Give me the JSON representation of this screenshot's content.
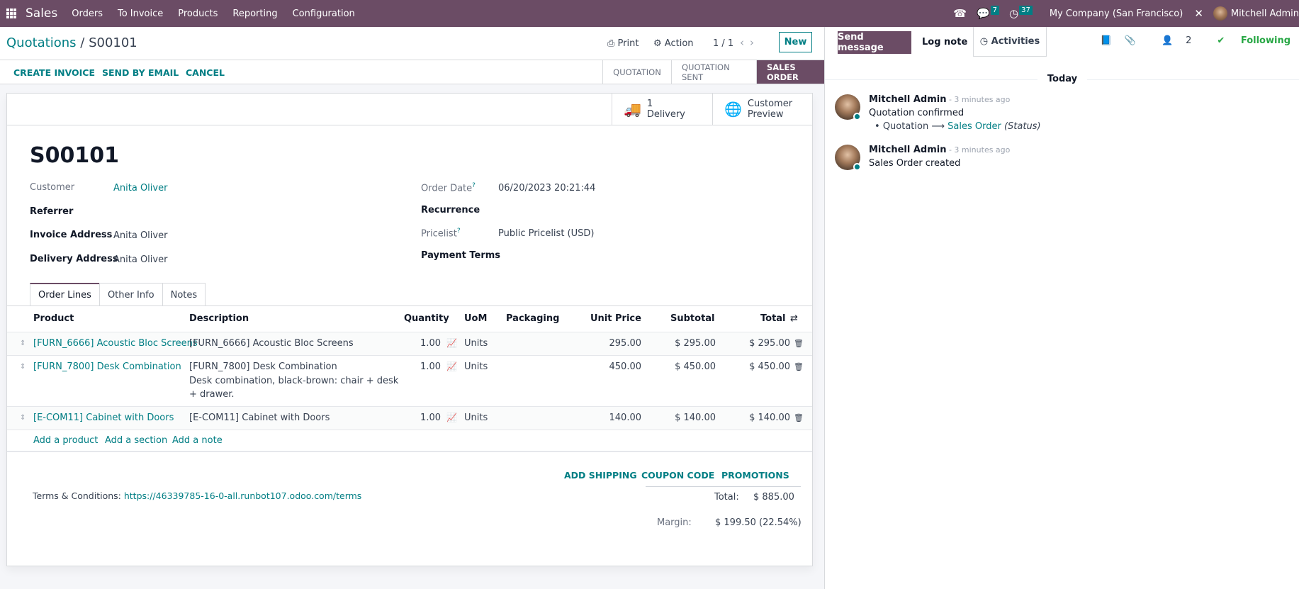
{
  "navbar": {
    "app_name": "Sales",
    "menu": [
      "Orders",
      "To Invoice",
      "Products",
      "Reporting",
      "Configuration"
    ],
    "messages_count": "7",
    "activities_count": "37",
    "company": "My Company (San Francisco)",
    "user": "Mitchell Admin"
  },
  "control_panel": {
    "breadcrumb_parent": "Quotations",
    "breadcrumb_sep": " / ",
    "breadcrumb_current": "S00101",
    "print_label": "Print",
    "action_label": "Action",
    "pager": "1 / 1",
    "new_label": "New"
  },
  "status_bar": {
    "buttons": [
      "CREATE INVOICE",
      "SEND BY EMAIL",
      "CANCEL"
    ],
    "stages": [
      "QUOTATION",
      "QUOTATION SENT",
      "SALES ORDER"
    ],
    "active_stage": "SALES ORDER"
  },
  "smart_buttons": {
    "delivery_count": "1",
    "delivery_label": "Delivery",
    "preview_line1": "Customer",
    "preview_line2": "Preview"
  },
  "form": {
    "name": "S00101",
    "customer_label": "Customer",
    "customer": "Anita Oliver",
    "referrer_label": "Referrer",
    "invoice_address_label": "Invoice Address",
    "invoice_address": "Anita Oliver",
    "delivery_address_label": "Delivery Address",
    "delivery_address": "Anita Oliver",
    "order_date_label": "Order Date",
    "order_date": "06/20/2023 20:21:44",
    "recurrence_label": "Recurrence",
    "pricelist_label": "Pricelist",
    "pricelist": "Public Pricelist (USD)",
    "payment_terms_label": "Payment Terms",
    "help_mark": "?"
  },
  "tabs": [
    "Order Lines",
    "Other Info",
    "Notes"
  ],
  "order_lines": {
    "columns": [
      "Product",
      "Description",
      "Quantity",
      "UoM",
      "Packaging",
      "Unit Price",
      "Subtotal",
      "Total"
    ],
    "rows": [
      {
        "product": "[FURN_6666] Acoustic Bloc Screens",
        "description": [
          "[FURN_6666] Acoustic Bloc Screens"
        ],
        "quantity": "1.00",
        "uom": "Units",
        "packaging": "",
        "unit_price": "295.00",
        "subtotal": "$ 295.00",
        "total": "$ 295.00"
      },
      {
        "product": "[FURN_7800] Desk Combination",
        "description": [
          "[FURN_7800] Desk Combination",
          "Desk combination, black-brown: chair + desk",
          "+ drawer."
        ],
        "quantity": "1.00",
        "uom": "Units",
        "packaging": "",
        "unit_price": "450.00",
        "subtotal": "$ 450.00",
        "total": "$ 450.00"
      },
      {
        "product": "[E-COM11] Cabinet with Doors",
        "description": [
          "[E-COM11] Cabinet with Doors"
        ],
        "quantity": "1.00",
        "uom": "Units",
        "packaging": "",
        "unit_price": "140.00",
        "subtotal": "$ 140.00",
        "total": "$ 140.00"
      }
    ],
    "add_links": [
      "Add a product",
      "Add a section",
      "Add a note"
    ]
  },
  "footer": {
    "buttons": [
      "ADD SHIPPING",
      "COUPON CODE",
      "PROMOTIONS"
    ],
    "terms_label": "Terms & Conditions: ",
    "terms_url": "https://46339785-16-0-all.runbot107.odoo.com/terms",
    "total_label": "Total:",
    "total": "$ 885.00",
    "margin_label": "Margin:",
    "margin": "$ 199.50 (22.54%)"
  },
  "chatter": {
    "send_message": "Send message",
    "log_note": "Log note",
    "activities": "Activities",
    "followers_count": "2",
    "following": "Following",
    "date_separator": "Today",
    "messages": [
      {
        "author": "Mitchell Admin",
        "ago": " - 3 minutes ago",
        "body": "Quotation confirmed",
        "tracking": {
          "old": "Quotation",
          "new": "Sales Order",
          "field": "(Status)"
        }
      },
      {
        "author": "Mitchell Admin",
        "ago": " - 3 minutes ago",
        "body": "Sales Order created"
      }
    ]
  },
  "colors": {
    "brand": "#6b4c65",
    "accent": "#017e84",
    "following": "#28a745"
  }
}
